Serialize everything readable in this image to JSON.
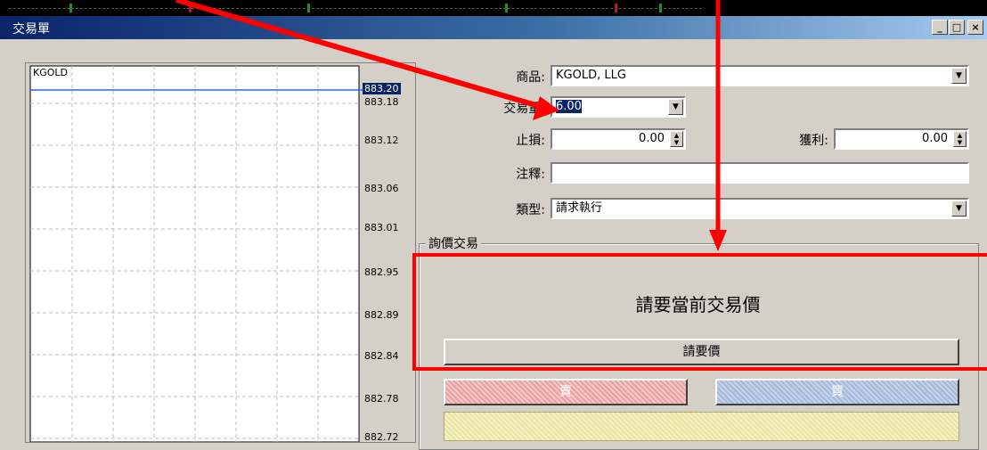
{
  "window": {
    "title": "交易單",
    "minimize": "_",
    "maximize": "□",
    "close": "×"
  },
  "chart": {
    "symbol": "KGOLD",
    "current_price": "883.20",
    "price_labels": [
      "883.18",
      "883.12",
      "883.06",
      "883.01",
      "882.95",
      "882.89",
      "882.84",
      "882.78",
      "882.72"
    ]
  },
  "form": {
    "symbol_label": "商品:",
    "symbol_value": "KGOLD, LLG",
    "volume_label": "交易量:",
    "volume_value": "6.00",
    "stop_loss_label": "止損:",
    "stop_loss_value": "0.00",
    "take_profit_label": "獲利:",
    "take_profit_value": "0.00",
    "comment_label": "注釋:",
    "comment_value": "",
    "type_label": "類型:",
    "type_value": "請求執行"
  },
  "quote": {
    "group_title": "詢價交易",
    "request_text": "請要當前交易價",
    "request_button": "請要價",
    "sell_button": "賣",
    "buy_button": "買"
  },
  "colors": {
    "annotation": "#ff0000",
    "title_start": "#0a246a",
    "title_end": "#a6caf0"
  }
}
